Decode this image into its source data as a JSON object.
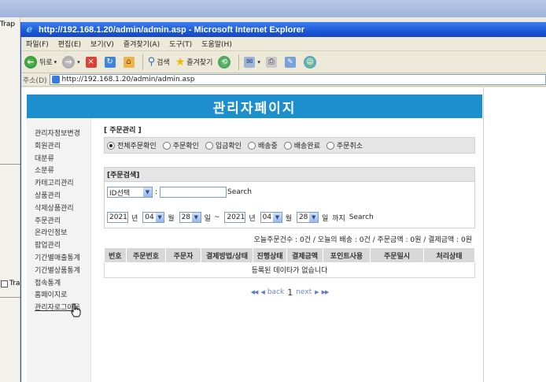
{
  "background_window": {
    "label_top": "Trap",
    "label_bottom": "Tra"
  },
  "window": {
    "title": "http://192.168.1.20/admin/admin.asp - Microsoft Internet Explorer",
    "menu": [
      "파일(F)",
      "편집(E)",
      "보기(V)",
      "즐겨찾기(A)",
      "도구(T)",
      "도움말(H)"
    ],
    "toolbar": {
      "back": "뒤로",
      "search": "검색",
      "favorites": "즐겨찾기"
    },
    "address_label": "주소(D)",
    "address_value": "http://192.168.1.20/admin/admin.asp"
  },
  "page": {
    "banner": "관리자페이지",
    "sidebar": [
      {
        "label": "관리자정보변경"
      },
      {
        "label": "회원관리"
      },
      {
        "label": "대분류"
      },
      {
        "label": "소분류"
      },
      {
        "label": "카테고리관리"
      },
      {
        "label": "상품관리"
      },
      {
        "label": "삭제상품관리"
      },
      {
        "label": "주문관리"
      },
      {
        "label": "온라인정보"
      },
      {
        "label": "팝업관리"
      },
      {
        "label": "기간별매출통계"
      },
      {
        "label": "기간별상품통계"
      },
      {
        "label": "접속통계"
      },
      {
        "label": "홈페이지로"
      },
      {
        "label": "관리자로그아웃"
      }
    ],
    "order_section_title": "[ 주문관리 ]",
    "order_filters": [
      {
        "label": "전체주문확인",
        "selected": true
      },
      {
        "label": "주문확인",
        "selected": false
      },
      {
        "label": "입금확인",
        "selected": false
      },
      {
        "label": "배송중",
        "selected": false
      },
      {
        "label": "배송완료",
        "selected": false
      },
      {
        "label": "주문취소",
        "selected": false
      }
    ],
    "search_title": "[주문검색]",
    "search": {
      "field_select": "ID선택",
      "colon": ":",
      "text_value": "",
      "search_label": "Search",
      "from": {
        "year": "2021",
        "month": "04",
        "day": "28"
      },
      "to": {
        "year": "2021",
        "month": "04",
        "day": "28"
      },
      "year_unit": "년",
      "month_unit": "월",
      "day_unit": "일",
      "tilde": "~",
      "until": "까지",
      "search_label2": "Search"
    },
    "summary": "오늘주문건수 : 0건 / 오늘의 배송 : 0건 / 주문금액 : 0원 / 결제금액 : 0원",
    "table": {
      "headers": [
        "번호",
        "주문번호",
        "주문자",
        "결제방법/상태",
        "진행상태",
        "결제금액",
        "포인트사용",
        "주문일시",
        "처리상태"
      ],
      "empty_message": "등록된 데이타가 없습니다"
    },
    "pager": {
      "back": "back",
      "current": "1",
      "next": "next"
    }
  }
}
